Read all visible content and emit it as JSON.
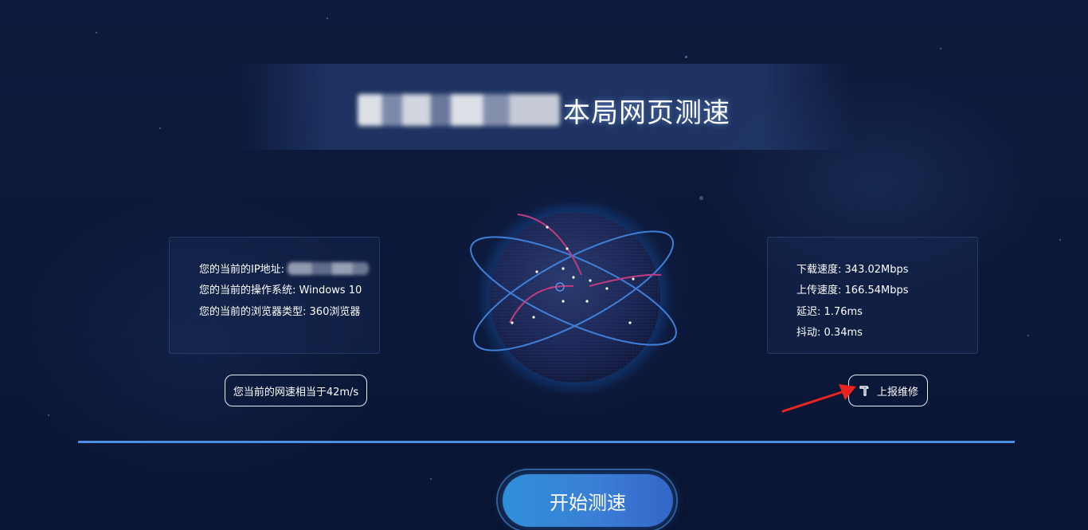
{
  "header": {
    "title_visible": "本局网页测速"
  },
  "client_info": {
    "ip_label": "您的当前的IP地址:",
    "os_label": "您的当前的操作系统:",
    "os_value": "Windows 10",
    "browser_label": "您的当前的浏览器类型:",
    "browser_value": "360浏览器"
  },
  "results": {
    "download_label": "下载速度:",
    "download_value": "343.02Mbps",
    "upload_label": "上传速度:",
    "upload_value": "166.54Mbps",
    "latency_label": "延迟:",
    "latency_value": "1.76ms",
    "jitter_label": "抖动:",
    "jitter_value": "0.34ms"
  },
  "buttons": {
    "speed_equivalent": "您当前的网速相当于42m/s",
    "report_repair": "上报维修",
    "start_test": "开始测速"
  },
  "icons": {
    "repair": "hammer-icon"
  },
  "colors": {
    "background": "#0c1838",
    "accent_blue": "#4a8ee6",
    "orbit_blue": "#3f7fd8",
    "orbit_pink": "#c03c7e",
    "annotation_red": "#e8241f"
  }
}
